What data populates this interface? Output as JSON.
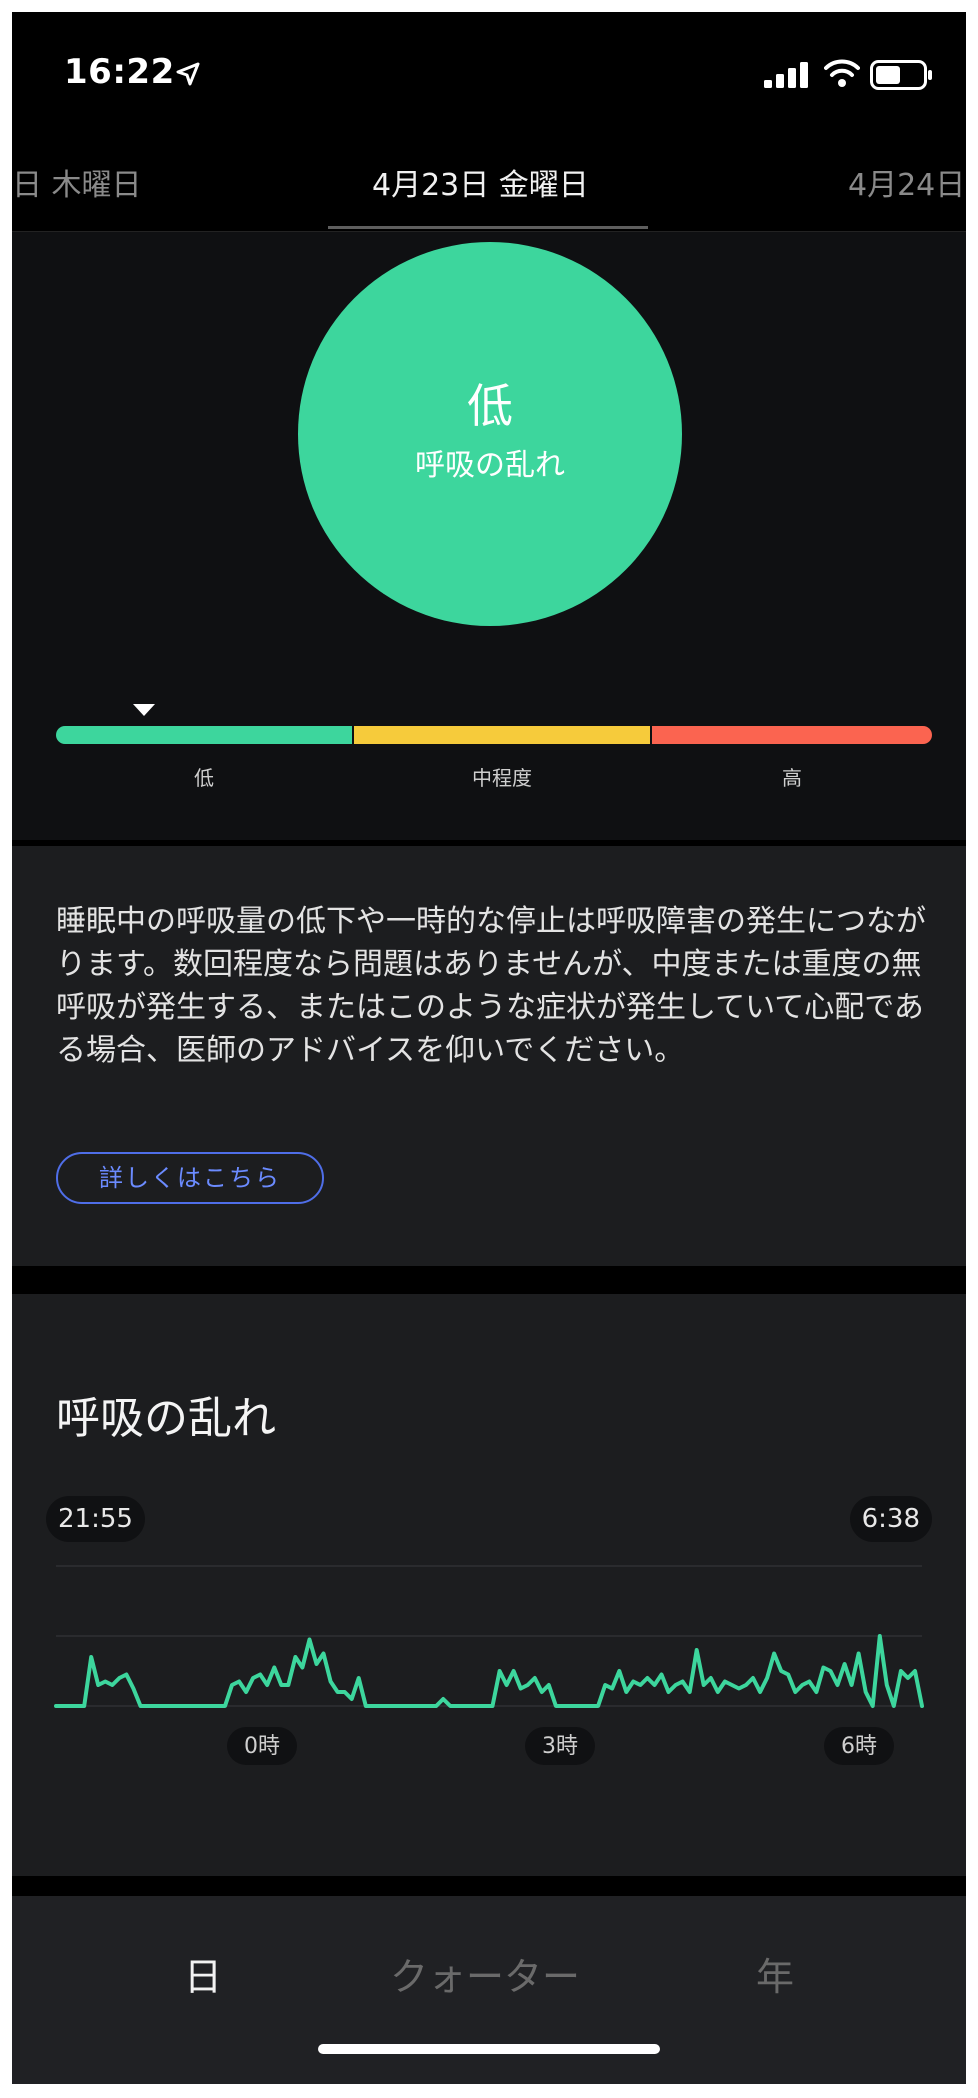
{
  "status_bar": {
    "time": "16:22",
    "icons": [
      "location-arrow-icon",
      "cellular-signal-icon",
      "wifi-icon",
      "battery-icon"
    ]
  },
  "date_tabs": {
    "previous": "日 木曜日",
    "current": "4月23日 金曜日",
    "next": "4月24日"
  },
  "summary": {
    "level": "低",
    "label": "呼吸の乱れ",
    "scale": [
      "低",
      "中程度",
      "高"
    ],
    "current_level_index": 0,
    "marker_position_fraction": 0.1,
    "colors": {
      "low": "#3dd69d",
      "moderate": "#f6cb3b",
      "high": "#fb6450"
    }
  },
  "info": {
    "text": "睡眠中の呼吸量の低下や一時的な停止は呼吸障害の発生につながります。数回程度なら問題はありませんが、中度または重度の無呼吸が発生する、またはこのような症状が発生していて心配である場合、医師のアドバイスを仰いでください。",
    "button_label": "詳しくはこちら"
  },
  "chart": {
    "title": "呼吸の乱れ",
    "start_time": "21:55",
    "end_time": "6:38",
    "color": "#3dd69d",
    "chart_data": {
      "type": "line",
      "xlabel": "",
      "ylabel": "",
      "x_tick_labels": [
        "0時",
        "3時",
        "6時"
      ],
      "grid": true,
      "series": [
        {
          "values": [
            0,
            0,
            0,
            0,
            0,
            0.7,
            0.3,
            0.35,
            0.3,
            0.4,
            0.45,
            0.25,
            0,
            0,
            0,
            0,
            0,
            0,
            0,
            0,
            0,
            0,
            0,
            0,
            0,
            0.3,
            0.35,
            0.2,
            0.4,
            0.45,
            0.3,
            0.55,
            0.3,
            0.3,
            0.7,
            0.55,
            0.95,
            0.6,
            0.75,
            0.35,
            0.2,
            0.2,
            0.1,
            0.4,
            0,
            0,
            0,
            0,
            0,
            0,
            0,
            0,
            0,
            0,
            0,
            0.1,
            0,
            0,
            0,
            0,
            0,
            0,
            0,
            0.5,
            0.3,
            0.5,
            0.25,
            0.3,
            0.4,
            0.2,
            0.3,
            0,
            0,
            0,
            0,
            0,
            0,
            0,
            0.3,
            0.25,
            0.5,
            0.2,
            0.35,
            0.3,
            0.4,
            0.3,
            0.45,
            0.2,
            0.3,
            0.35,
            0.2,
            0.8,
            0.3,
            0.4,
            0.2,
            0.35,
            0.3,
            0.25,
            0.3,
            0.4,
            0.2,
            0.4,
            0.75,
            0.5,
            0.45,
            0.2,
            0.3,
            0.35,
            0.2,
            0.55,
            0.5,
            0.3,
            0.6,
            0.3,
            0.75,
            0.2,
            0,
            1,
            0.3,
            0,
            0.5,
            0.4,
            0.5,
            0
          ]
        }
      ]
    }
  },
  "period_tabs": [
    "日",
    "クォーター",
    "年"
  ],
  "selected_period": "日"
}
